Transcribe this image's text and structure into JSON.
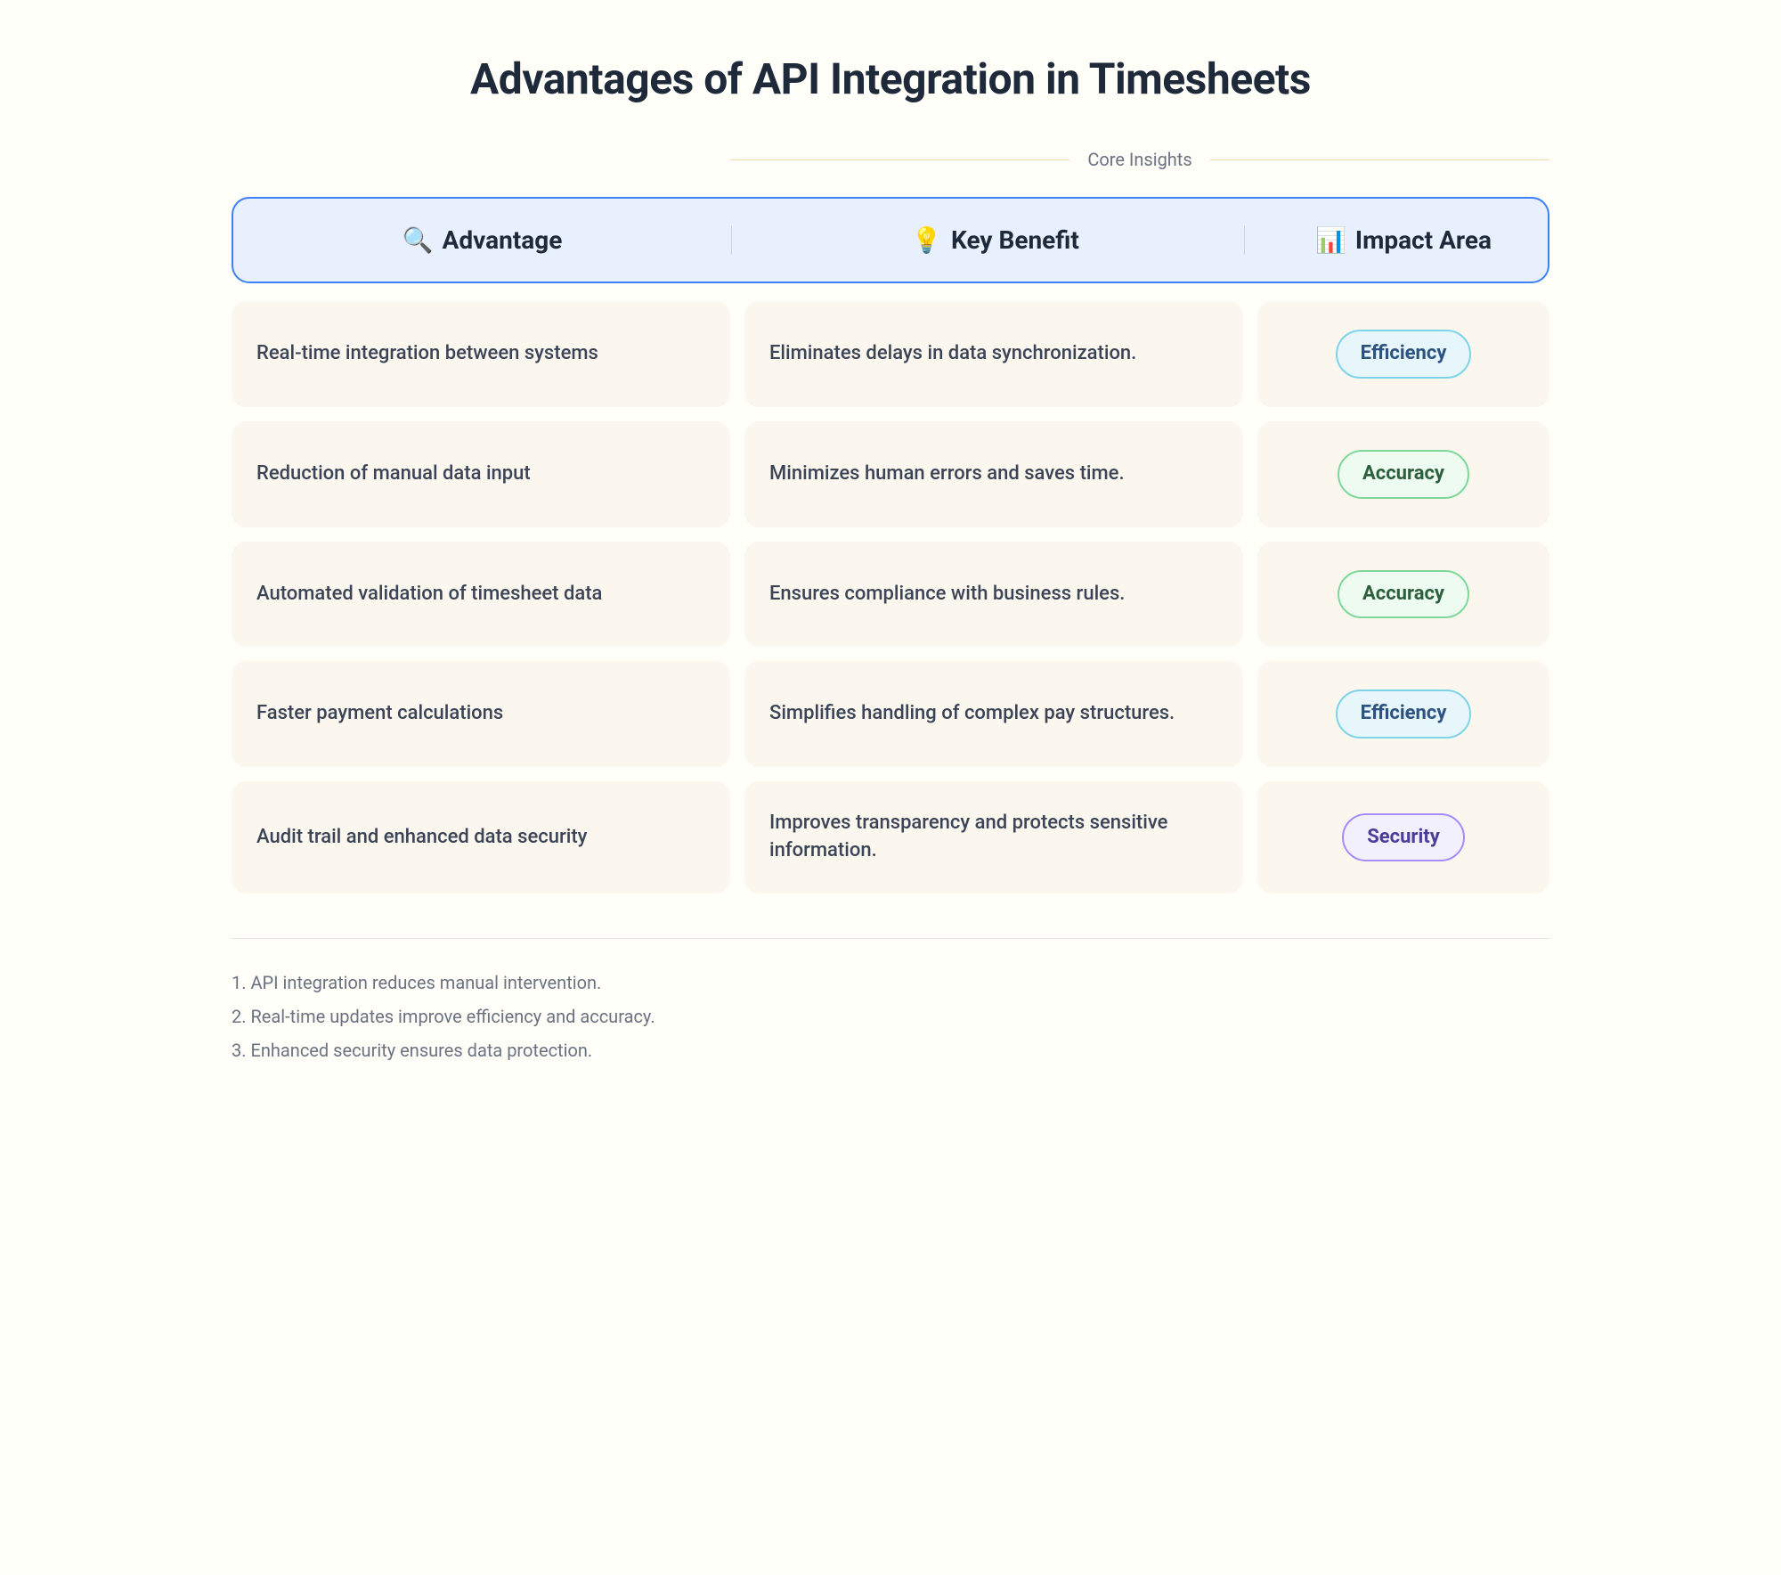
{
  "title": "Advantages of API Integration in Timesheets",
  "insights_label": "Core Insights",
  "columns": {
    "advantage": {
      "icon": "🔍",
      "label": "Advantage"
    },
    "benefit": {
      "icon": "💡",
      "label": "Key Benefit"
    },
    "impact": {
      "icon": "📊",
      "label": "Impact Area"
    }
  },
  "rows": [
    {
      "advantage": "Real-time integration between systems",
      "benefit": "Eliminates delays in data synchronization.",
      "impact": "Efficiency",
      "impact_type": "efficiency"
    },
    {
      "advantage": "Reduction of manual data input",
      "benefit": "Minimizes human errors and saves time.",
      "impact": "Accuracy",
      "impact_type": "accuracy"
    },
    {
      "advantage": "Automated validation of timesheet data",
      "benefit": "Ensures compliance with business rules.",
      "impact": "Accuracy",
      "impact_type": "accuracy"
    },
    {
      "advantage": "Faster payment calculations",
      "benefit": "Simplifies handling of complex pay structures.",
      "impact": "Efficiency",
      "impact_type": "efficiency"
    },
    {
      "advantage": "Audit trail and enhanced data security",
      "benefit": "Improves transparency and protects sensitive information.",
      "impact": "Security",
      "impact_type": "security"
    }
  ],
  "footer": [
    "API integration reduces manual intervention.",
    "Real-time updates improve efficiency and accuracy.",
    "Enhanced security ensures data protection."
  ]
}
